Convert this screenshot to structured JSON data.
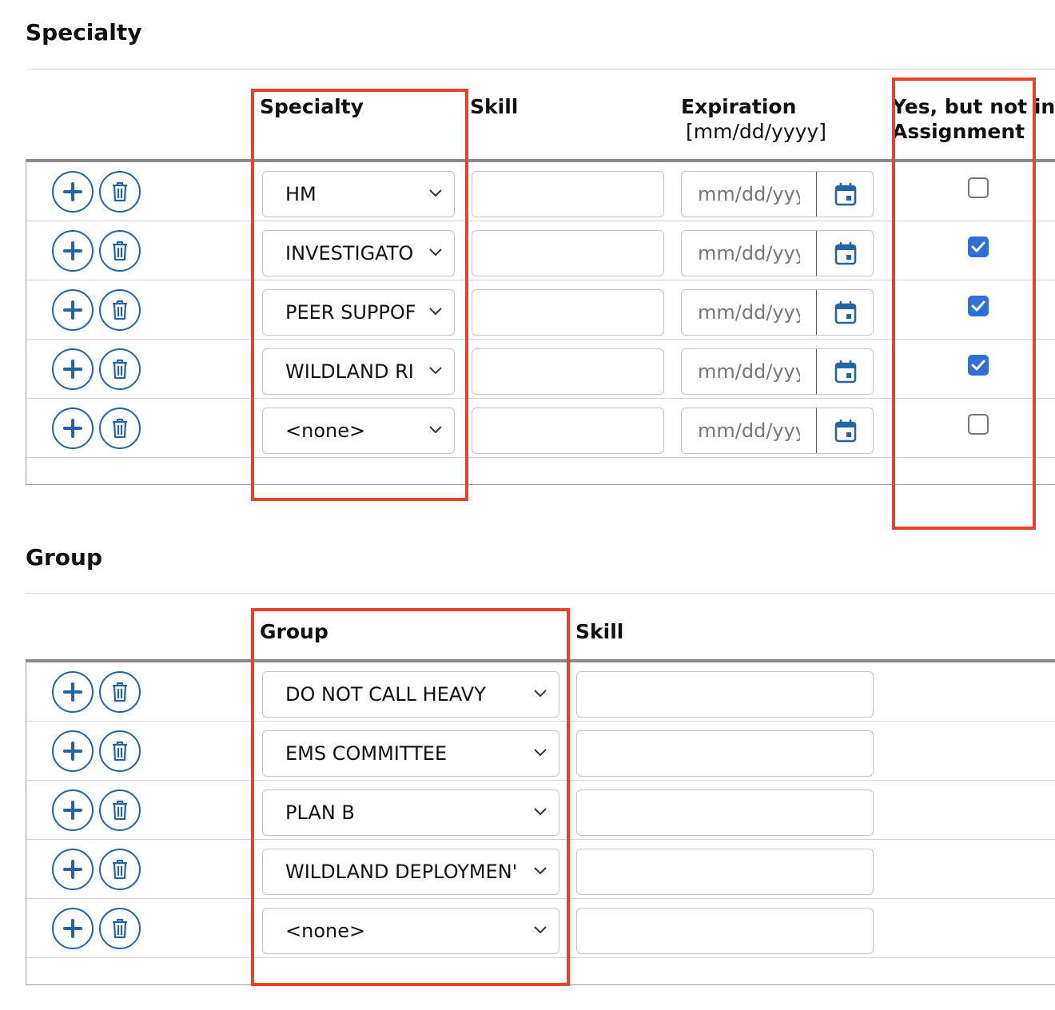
{
  "specialty": {
    "section_title": "Specialty",
    "col_specialty": "Specialty",
    "col_skill": "Skill",
    "col_expiration": "Expiration",
    "col_expiration_format": "[mm/dd/yyyy]",
    "col_yes_line1": "Yes, but not in",
    "col_yes_line2": "Assignment",
    "date_placeholder": "mm/dd/yyyy",
    "rows": [
      {
        "value": "HM",
        "checked": false
      },
      {
        "value": "INVESTIGATO",
        "checked": true
      },
      {
        "value": "PEER SUPPOF",
        "checked": true
      },
      {
        "value": "WILDLAND RI",
        "checked": true
      },
      {
        "value": "<none>",
        "checked": false
      }
    ]
  },
  "group": {
    "section_title": "Group",
    "col_group": "Group",
    "col_skill": "Skill",
    "rows": [
      {
        "value": "DO NOT CALL HEAVY"
      },
      {
        "value": "EMS COMMITTEE"
      },
      {
        "value": "PLAN B"
      },
      {
        "value": "WILDLAND DEPLOYMEN'"
      },
      {
        "value": "<none>"
      }
    ]
  },
  "colors": {
    "accent": "#2463a5",
    "checkbox_on": "#2f6fd6",
    "highlight": "#e5432b"
  },
  "icons": {
    "add": "plus-icon",
    "delete": "trash-icon",
    "dropdown": "chevron-down-icon",
    "calendar": "calendar-icon"
  }
}
